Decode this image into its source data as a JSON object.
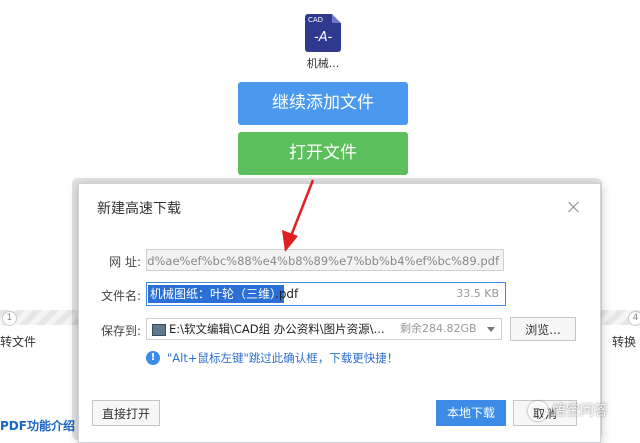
{
  "background": {
    "file_icon": {
      "icon": "cad-file-icon",
      "tag": "CAD",
      "glyph": "-A-"
    },
    "file_name": "机械...",
    "add_button_label": "继续添加文件",
    "open_button_label": "打开文件",
    "step_left_num": "1",
    "step_right_num": "4",
    "step_left_label": "转文件",
    "step_right_label": "转换",
    "pdf_intro": "PDF功能介绍"
  },
  "dialog": {
    "title": "新建高速下载",
    "close_icon": "close-icon",
    "url_label": "网  址:",
    "url_value": "d%ae%ef%bc%88%e4%b8%89%e7%bb%b4%ef%bc%89.pdf",
    "filename_label": "文件名:",
    "filename_selected": "机械图纸：叶轮（三维）",
    "filename_ext": ".pdf",
    "file_size": "33.5 KB",
    "saveto_label": "保存到:",
    "save_path": "E:\\软文编辑\\CAD组 办公资料\\图片资源\\...",
    "free_space": "剩余284.82GB",
    "browse_label": "浏览...",
    "tip_icon": "info-icon",
    "tip_text": "\"Alt+鼠标左键\"跳过此确认框，下载更快捷！",
    "open_direct_label": "直接打开",
    "local_download_label": "本地下载",
    "cancel_label": "取消"
  },
  "colors": {
    "accent_blue": "#3c8ce7",
    "add_button": "#4a99ef",
    "open_button": "#5bbf5b",
    "arrow": "#e02020"
  },
  "watermark": {
    "text": "悟空问答"
  }
}
